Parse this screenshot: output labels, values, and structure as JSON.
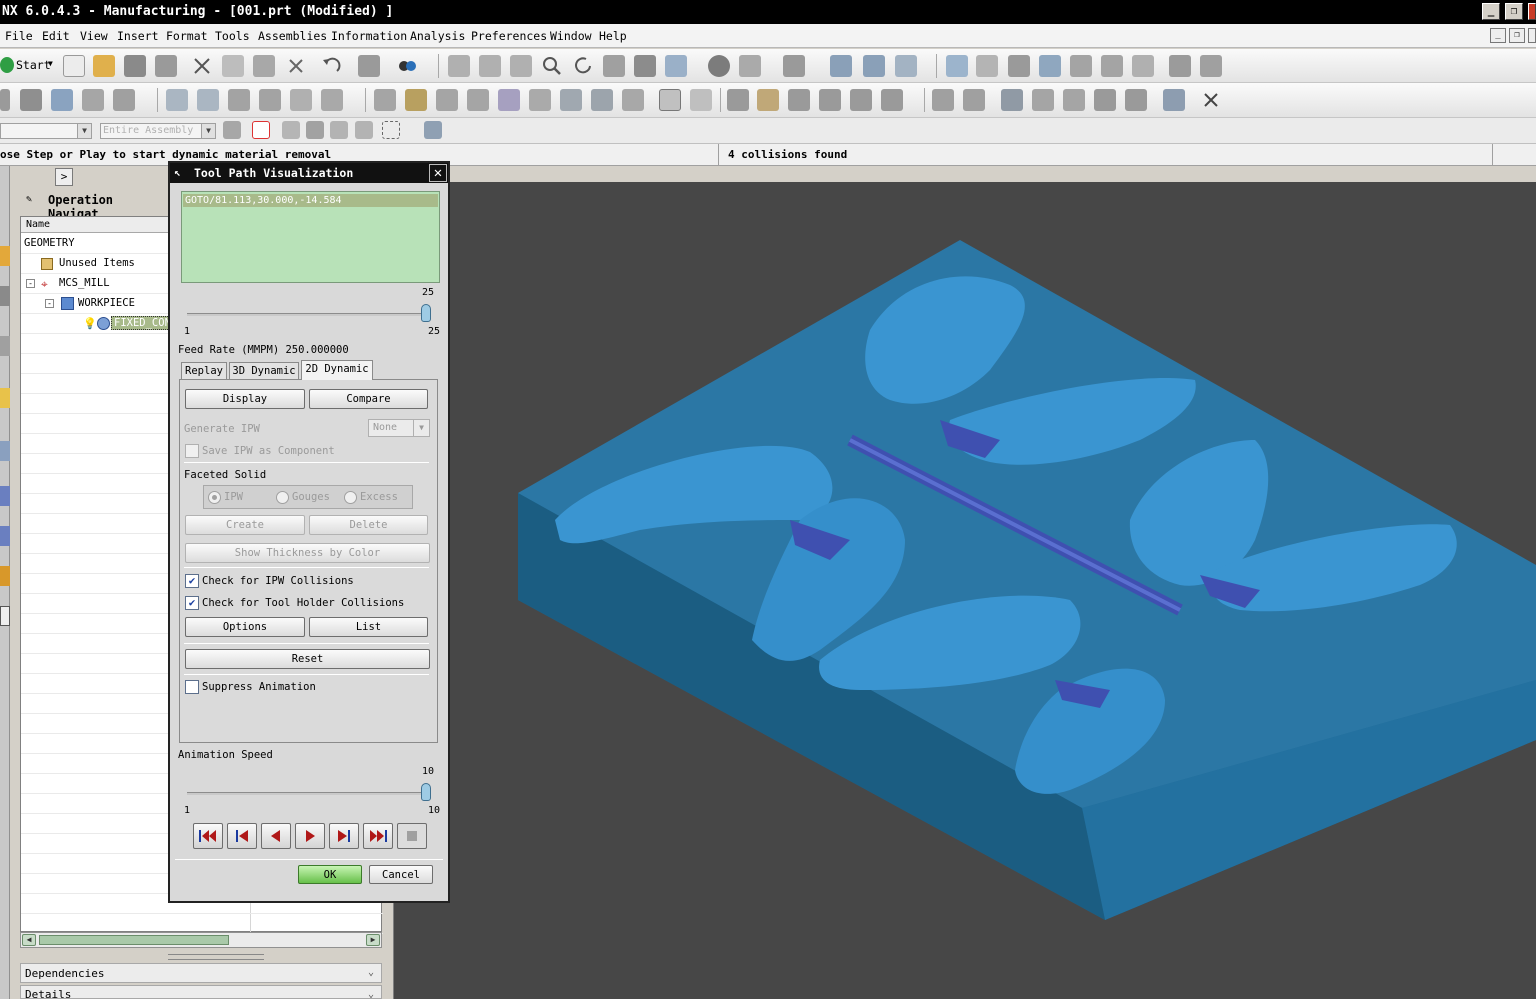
{
  "window": {
    "title": "NX 6.0.4.3 - Manufacturing - [001.prt (Modified) ]",
    "controls": [
      "_",
      "❐",
      "✕"
    ]
  },
  "menu": [
    "File",
    "Edit",
    "View",
    "Insert",
    "Format",
    "Tools",
    "Assemblies",
    "Information",
    "Analysis",
    "Preferences",
    "Window",
    "Help"
  ],
  "toolbar": {
    "start_label": "Start",
    "assembly_combo": "Entire Assembly"
  },
  "status": {
    "prompt": "ose Step or Play to start dynamic material removal",
    "message": "4 collisions found"
  },
  "navigator": {
    "title": "Operation Navigat",
    "column_name": "Name",
    "rows": [
      {
        "label": "GEOMETRY"
      },
      {
        "label": "Unused Items"
      },
      {
        "label": "MCS_MILL"
      },
      {
        "label": "WORKPIECE"
      },
      {
        "label": "FIXED_CON"
      }
    ],
    "dependencies_label": "Dependencies",
    "details_label": "Details"
  },
  "dialog": {
    "title": "Tool Path Visualization",
    "list_selected": "GOTO/81.113,30.000,-14.584",
    "motion_slider": {
      "min": "1",
      "max": "25",
      "value": "25",
      "position": 1.0
    },
    "feed_rate": "Feed Rate (MMPM) 250.000000",
    "tabs": [
      "Replay",
      "3D Dynamic",
      "2D Dynamic"
    ],
    "active_tab": "2D Dynamic",
    "display_label": "Display",
    "compare_label": "Compare",
    "generate_ipw_label": "Generate IPW",
    "generate_ipw_value": "None",
    "save_ipw_label": "Save IPW as Component",
    "faceted_solid_label": "Faceted Solid",
    "radio_ipw": "IPW",
    "radio_gouges": "Gouges",
    "radio_excess": "Excess",
    "create_label": "Create",
    "delete_label": "Delete",
    "show_thickness_label": "Show Thickness by Color",
    "check_ipw_collisions": "Check for IPW Collisions",
    "check_holder_collisions": "Check for Tool Holder Collisions",
    "options_label": "Options",
    "list_label": "List",
    "reset_label": "Reset",
    "suppress_animation": "Suppress Animation",
    "animation_speed_label": "Animation Speed",
    "speed_slider": {
      "min": "1",
      "max": "10",
      "value": "10",
      "position": 1.0
    },
    "ok_label": "OK",
    "cancel_label": "Cancel"
  },
  "colors": {
    "part_top": "#2b77a5",
    "part_side_light": "#1f6d99",
    "part_side_dark": "#1b5d82",
    "cavity": "#3a95d1",
    "channel": "#3f50b0",
    "viewport_bg": "#474747",
    "list_bg": "#b8e2b8"
  }
}
